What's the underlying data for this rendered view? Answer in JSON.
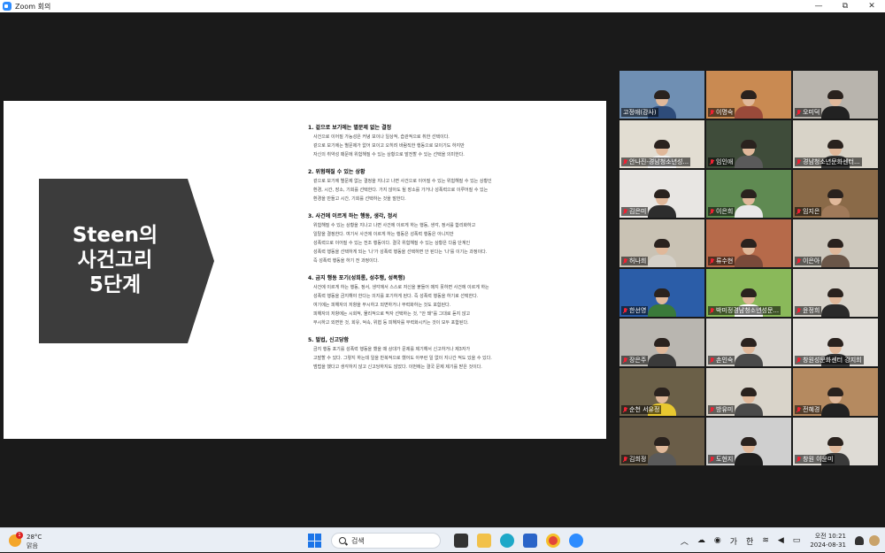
{
  "window": {
    "title": "Zoom 회의",
    "minimize": "—",
    "restore": "⧉",
    "close": "✕"
  },
  "slide": {
    "heading_lines": [
      "Steen의",
      "사건고리",
      "5단계"
    ],
    "sections": [
      {
        "title": "1. 겉으로 보기에는 별문제 없는 결정",
        "lines": [
          "사건으로 이어질 가능성은 커녕 보이나 일상적, 습관적으로 취한 선택이다.",
          "겉으로 보기에는 별문제가 없어 보이고 오히려 바람직한 행동으로 보이기도 하지만",
          "자신의 취약성 때문에 위험해질 수 있는 상황으로 발전할 수 있는 선택을 의미한다."
        ]
      },
      {
        "title": "2. 위험해질 수 있는 상황",
        "lines": [
          "겉으로 보기에 별문제 없는 결정을 지나고 나면 사건으로 이어질 수 있는 위험해질 수 있는 상황인",
          "환경, 시간, 장소, 기회를 선택한다. 가지 않아도 될 장소를 가거나 성폭력으로 이루어질 수 있는",
          "환경을 만들고 시간, 기회를 선택하는 것을 말한다."
        ]
      },
      {
        "title": "3. 사건에 이르게 하는 행동, 생각, 정서",
        "lines": [
          "위험해질 수 있는 상황을 지나고 나면 사건에 이르게 하는 행동, 생각, 정서를 합리화하고",
          "일탈을 결정한다. 여기서 사건에 이르게 하는 행동은 성폭력 행동은 아니지만",
          "성폭력으로 이어질 수 있는 전조 행동이다. 결국 위험해질 수 있는 상황은 다음 단계인",
          "성폭력 행동을 선택하게 되는 '나'가 성폭력 행동을 선택하면 안 된다는 '나'를 이기는 과정이다.",
          "즉 성폭력 행동을 하기 전 과정이다."
        ]
      },
      {
        "title": "4. 금지 행동 포기(성희롱, 성추행, 성폭행)",
        "lines": [
          "사건에 이르게 하는 행동, 정서, 생각에서 스스로 자신을 붙들어 매지 못하면 사건에 이르게 하는",
          "성폭력 행동을 금지해야 한다는 의지를 포기하게 된다. 즉 성폭력 행동을 하기로 선택한다.",
          "여기에는 피해자의 저항을 무시하고 외면하거나 무력화하는 것도 포함된다.",
          "피해자의 저항에는 시회적, 물리적으로 막자 선택하는 것, \"안 돼\"를 그대로 듣지 않고",
          "무시하고 외면한 것, 회유, 억속, 위협 등 피해자를 무력화시키는 것이 모두 포함된다."
        ]
      },
      {
        "title": "5. 벌법, 신고당함",
        "lines": [
          "금지 행동 포기를 성폭력 행동을 했을 때 상대가 문제를 제기해서 신고하거나 제3자가",
          "고발할 수 있다. 그렇지 하는데 일을 반복적으로 했어도 아무런 일 없이 지나간 적도 있을 수 있다.",
          "범법을 했다고 생각하지 않고 신고당하지도 않았다. 이번에는 결국 문제 제기를 받은 것이다."
        ]
      }
    ]
  },
  "participants": [
    {
      "name": "고정애(강사)",
      "muted": false,
      "active": true,
      "bg": "#6f8fb3",
      "shirt": "#2e4c7a"
    },
    {
      "name": "이명숙",
      "muted": true,
      "active": false,
      "bg": "#c98a52",
      "shirt": "#9a4a3a"
    },
    {
      "name": "오미덕",
      "muted": true,
      "active": false,
      "bg": "#b8b4ad",
      "shirt": "#222222"
    },
    {
      "name": "안나진-경남청소년성...",
      "muted": true,
      "active": false,
      "bg": "#e2ddd2",
      "shirt": "#f2f2f2"
    },
    {
      "name": "임인애",
      "muted": true,
      "active": false,
      "bg": "#3f4c3a",
      "shirt": "#5a5a5a"
    },
    {
      "name": "경남청소년문화센터...",
      "muted": true,
      "active": false,
      "bg": "#d8d3c8",
      "shirt": "#3a3a3a"
    },
    {
      "name": "김은미",
      "muted": true,
      "active": false,
      "bg": "#e8e6e3",
      "shirt": "#2d2d2d"
    },
    {
      "name": "이은희",
      "muted": true,
      "active": false,
      "bg": "#5f8a52",
      "shirt": "#e8e8e8"
    },
    {
      "name": "임지은",
      "muted": true,
      "active": false,
      "bg": "#8a6a48",
      "shirt": "#a07a5a"
    },
    {
      "name": "허나희",
      "muted": true,
      "active": false,
      "bg": "#c9c2b4",
      "shirt": "#d4d0c8"
    },
    {
      "name": "류수현",
      "muted": true,
      "active": false,
      "bg": "#b66a4a",
      "shirt": "#7a4a3a"
    },
    {
      "name": "이은아",
      "muted": true,
      "active": false,
      "bg": "#cdc8bd",
      "shirt": "#6a5648"
    },
    {
      "name": "한선영",
      "muted": true,
      "active": false,
      "bg": "#2b5da8",
      "shirt": "#3a7a3a"
    },
    {
      "name": "박미정경남청소년성문...",
      "muted": true,
      "active": false,
      "bg": "#8ab95a",
      "shirt": "#ffffff"
    },
    {
      "name": "윤정희",
      "muted": true,
      "active": false,
      "bg": "#d7d3ca",
      "shirt": "#2a2a2a"
    },
    {
      "name": "장은주",
      "muted": true,
      "active": false,
      "bg": "#b9b6b0",
      "shirt": "#3a3a3a"
    },
    {
      "name": "손인숙",
      "muted": true,
      "active": false,
      "bg": "#d8d5cf",
      "shirt": "#4a4a4a"
    },
    {
      "name": "창원성문화센터 강지희",
      "muted": true,
      "active": false,
      "bg": "#e2dfda",
      "shirt": "#3a3a3a"
    },
    {
      "name": "순천 서유정",
      "muted": true,
      "active": false,
      "bg": "#6b6048",
      "shirt": "#e8c830"
    },
    {
      "name": "방유미",
      "muted": true,
      "active": false,
      "bg": "#d9d4ca",
      "shirt": "#4a4a4a"
    },
    {
      "name": "전혜경",
      "muted": true,
      "active": false,
      "bg": "#b58a60",
      "shirt": "#222222"
    },
    {
      "name": "김희정",
      "muted": true,
      "active": false,
      "bg": "#6a5d48",
      "shirt": "#5a5a5a"
    },
    {
      "name": "도현지",
      "muted": true,
      "active": false,
      "bg": "#cfcfcf",
      "shirt": "#1e1e1e"
    },
    {
      "name": "창원 이윤미",
      "muted": true,
      "active": false,
      "bg": "#dedbd5",
      "shirt": "#3a3a3a"
    }
  ],
  "taskbar": {
    "weather_temp": "28°C",
    "weather_desc": "맑음",
    "weather_badge": "1",
    "search_placeholder": "검색",
    "tray": {
      "chevron": "︿",
      "ime_ko": "가",
      "ime_han": "한"
    },
    "time": "오전 10:21",
    "date": "2024-08-31"
  },
  "colors": {
    "active_speaker": "#c8e04a",
    "chevron_fill": "#3c3c3c",
    "taskbar_bg": "#e9eef5"
  }
}
